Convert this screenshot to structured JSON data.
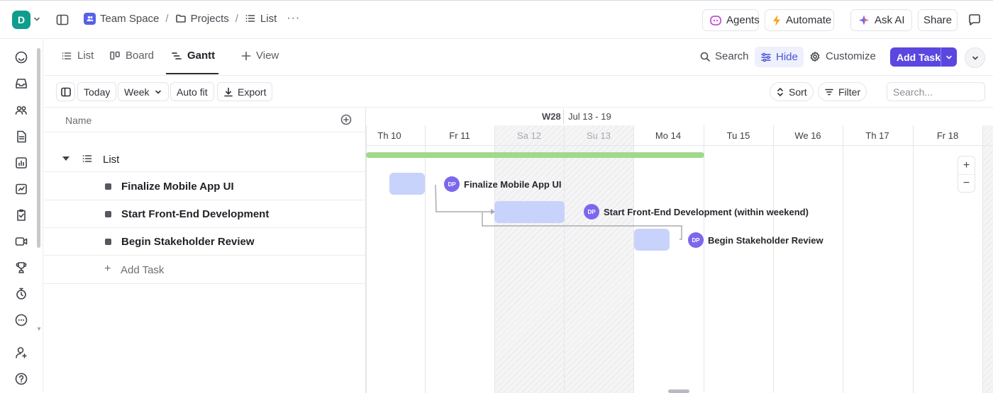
{
  "workspace": {
    "initial": "D"
  },
  "breadcrumb": {
    "space": "Team Space",
    "folder": "Projects",
    "list": "List",
    "more": "···"
  },
  "topbar": {
    "agents": "Agents",
    "automate": "Automate",
    "ask_ai": "Ask AI",
    "share": "Share"
  },
  "views": {
    "list": "List",
    "board": "Board",
    "gantt": "Gantt",
    "add_view": "View"
  },
  "view_tools": {
    "search": "Search",
    "hide": "Hide",
    "customize": "Customize",
    "add_task": "Add Task"
  },
  "toolbar": {
    "today": "Today",
    "scale": "Week",
    "auto_fit": "Auto fit",
    "export": "Export",
    "sort": "Sort",
    "filter": "Filter",
    "search_placeholder": "Search..."
  },
  "task_panel": {
    "column_name": "Name",
    "group_name": "List",
    "tasks": [
      {
        "name": "Finalize Mobile App UI"
      },
      {
        "name": "Start Front-End Development"
      },
      {
        "name": "Begin Stakeholder Review"
      }
    ],
    "add_task": "Add Task"
  },
  "gantt": {
    "week_number": "W28",
    "week_range": "Jul 13 - 19",
    "days": [
      {
        "label": "Th 10",
        "weekend": false
      },
      {
        "label": "Fr 11",
        "weekend": false
      },
      {
        "label": "Sa 12",
        "weekend": true
      },
      {
        "label": "Su 13",
        "weekend": true
      },
      {
        "label": "Mo 14",
        "weekend": false
      },
      {
        "label": "Tu 15",
        "weekend": false
      },
      {
        "label": "We 16",
        "weekend": false
      },
      {
        "label": "Th 17",
        "weekend": false
      },
      {
        "label": "Fr 18",
        "weekend": false
      }
    ],
    "bars": [
      {
        "label": "Finalize Mobile App UI",
        "assignee": "DP"
      },
      {
        "label": "Start Front-End Development (within weekend)",
        "assignee": "DP"
      },
      {
        "label": "Begin Stakeholder Review",
        "assignee": "DP"
      }
    ],
    "zoom_in": "+",
    "zoom_out": "−"
  },
  "colors": {
    "accent": "#5a47e0",
    "workspace": "#0f9d8c",
    "group_bar": "#9fd98a",
    "task_bar": "#c8d3fb",
    "avatar": "#7b68ee"
  }
}
